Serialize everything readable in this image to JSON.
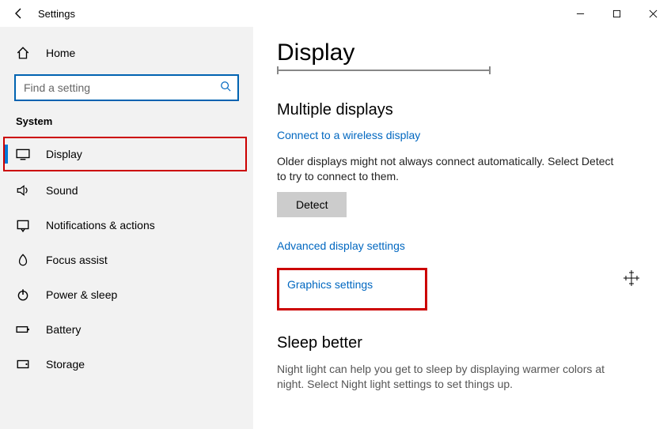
{
  "window": {
    "title": "Settings"
  },
  "sidebar": {
    "home": "Home",
    "search_placeholder": "Find a setting",
    "section": "System",
    "items": [
      {
        "label": "Display"
      },
      {
        "label": "Sound"
      },
      {
        "label": "Notifications & actions"
      },
      {
        "label": "Focus assist"
      },
      {
        "label": "Power & sleep"
      },
      {
        "label": "Battery"
      },
      {
        "label": "Storage"
      }
    ]
  },
  "main": {
    "page_title": "Display",
    "multiple_displays": {
      "heading": "Multiple displays",
      "connect_link": "Connect to a wireless display",
      "older_text": "Older displays might not always connect automatically. Select Detect to try to connect to them.",
      "detect_button": "Detect",
      "advanced_link": "Advanced display settings",
      "graphics_link": "Graphics settings"
    },
    "sleep_better": {
      "heading": "Sleep better",
      "text": "Night light can help you get to sleep by displaying warmer colors at night. Select Night light settings to set things up."
    }
  }
}
